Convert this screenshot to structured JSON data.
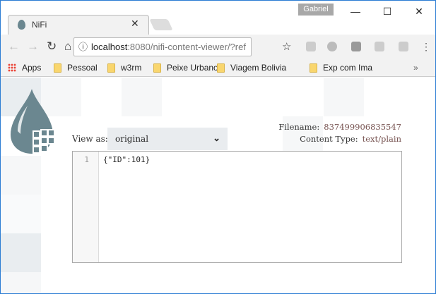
{
  "window": {
    "user": "Gabriel",
    "minimize": "—",
    "maximize": "☐",
    "close": "✕"
  },
  "tab": {
    "title": "NiFi",
    "close": "✕"
  },
  "address": {
    "host": "localhost",
    "rest": ":8080/nifi-content-viewer/?ref"
  },
  "bookmarks": [
    {
      "label": "Apps"
    },
    {
      "label": "Pessoal"
    },
    {
      "label": "w3rm"
    },
    {
      "label": "Peixe Urbano"
    },
    {
      "label": "Viagem Bolivia"
    },
    {
      "label": "Exp com Ima"
    }
  ],
  "bookmarks_more": "»",
  "viewer": {
    "view_as_label": "View as:",
    "view_as_value": "original",
    "filename_label": "Filename:",
    "filename": "837499906835547",
    "content_type_label": "Content Type:",
    "content_type": "text/plain",
    "lines": [
      {
        "num": "1",
        "text": "{\"ID\":101}"
      }
    ]
  }
}
